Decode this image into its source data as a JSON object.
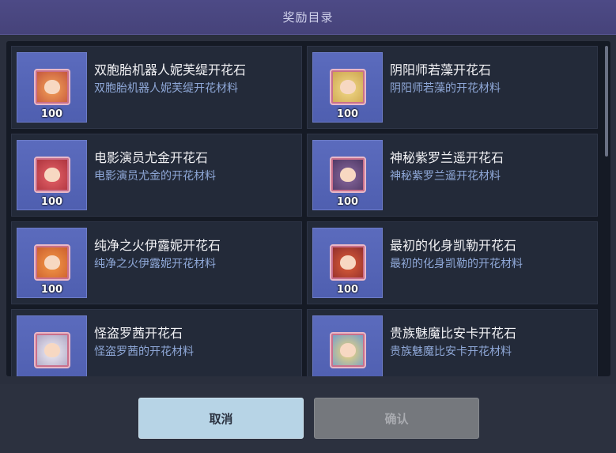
{
  "dialog": {
    "title": "奖励目录",
    "cancel_label": "取消",
    "confirm_label": "确认"
  },
  "items": [
    {
      "name": "双胞胎机器人妮芙缇开花石",
      "desc": "双胞胎机器人妮芙缇开花材料",
      "count": "100",
      "color1": "#f5a45a",
      "color2": "#c0503a"
    },
    {
      "name": "阴阳师若藻开花石",
      "desc": "阴阳师若藻的开花材料",
      "count": "100",
      "color1": "#f3dc8a",
      "color2": "#c9a04a"
    },
    {
      "name": "电影演员尤金开花石",
      "desc": "电影演员尤金的开花材料",
      "count": "100",
      "color1": "#e8646a",
      "color2": "#a8303a"
    },
    {
      "name": "神秘紫罗兰遥开花石",
      "desc": "神秘紫罗兰遥开花材料",
      "count": "100",
      "color1": "#8a6aa0",
      "color2": "#4a3460"
    },
    {
      "name": "纯净之火伊露妮开花石",
      "desc": "纯净之火伊露妮开花材料",
      "count": "100",
      "color1": "#f59a4a",
      "color2": "#c85a2a"
    },
    {
      "name": "最初的化身凯勒开花石",
      "desc": "最初的化身凯勒的开花材料",
      "count": "100",
      "color1": "#e0603a",
      "color2": "#8a2a2a"
    },
    {
      "name": "怪盗罗茜开花石",
      "desc": "怪盗罗茜的开花材料",
      "count": "",
      "color1": "#f0eef5",
      "color2": "#a8a0c0"
    },
    {
      "name": "贵族魅魔比安卡开花石",
      "desc": "贵族魅魔比安卡开花材料",
      "count": "",
      "color1": "#f5d87a",
      "color2": "#6a9ad0"
    }
  ]
}
